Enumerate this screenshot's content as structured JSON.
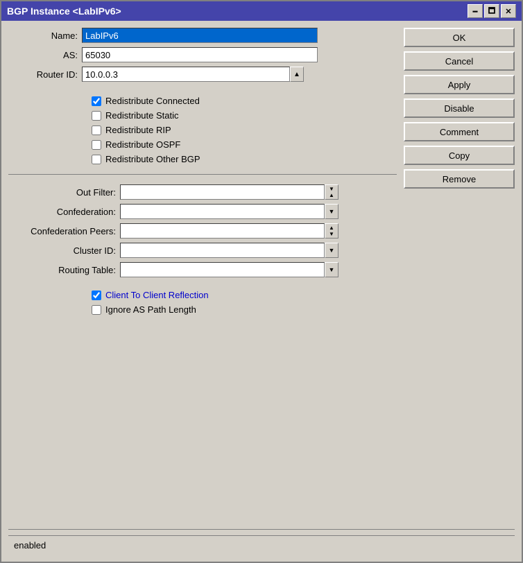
{
  "window": {
    "title": "BGP Instance <LabIPv6>",
    "controls": {
      "minimize": "🗕",
      "maximize": "🗖",
      "close": "✕"
    }
  },
  "form": {
    "name_label": "Name:",
    "name_value": "LabIPv6",
    "as_label": "AS:",
    "as_value": "65030",
    "router_id_label": "Router ID:",
    "router_id_value": "10.0.0.3",
    "redistribute_connected_label": "Redistribute Connected",
    "redistribute_connected_checked": true,
    "redistribute_static_label": "Redistribute Static",
    "redistribute_static_checked": false,
    "redistribute_rip_label": "Redistribute RIP",
    "redistribute_rip_checked": false,
    "redistribute_ospf_label": "Redistribute OSPF",
    "redistribute_ospf_checked": false,
    "redistribute_other_bgp_label": "Redistribute Other BGP",
    "redistribute_other_bgp_checked": false,
    "out_filter_label": "Out Filter:",
    "out_filter_value": "",
    "confederation_label": "Confederation:",
    "confederation_value": "",
    "confederation_peers_label": "Confederation Peers:",
    "confederation_peers_value": "",
    "cluster_id_label": "Cluster ID:",
    "cluster_id_value": "",
    "routing_table_label": "Routing Table:",
    "routing_table_value": "",
    "client_to_client_label": "Client To Client Reflection",
    "client_to_client_checked": true,
    "ignore_as_path_label": "Ignore AS Path Length",
    "ignore_as_path_checked": false
  },
  "buttons": {
    "ok": "OK",
    "cancel": "Cancel",
    "apply": "Apply",
    "disable": "Disable",
    "comment": "Comment",
    "copy": "Copy",
    "remove": "Remove"
  },
  "status": {
    "text": "enabled"
  }
}
